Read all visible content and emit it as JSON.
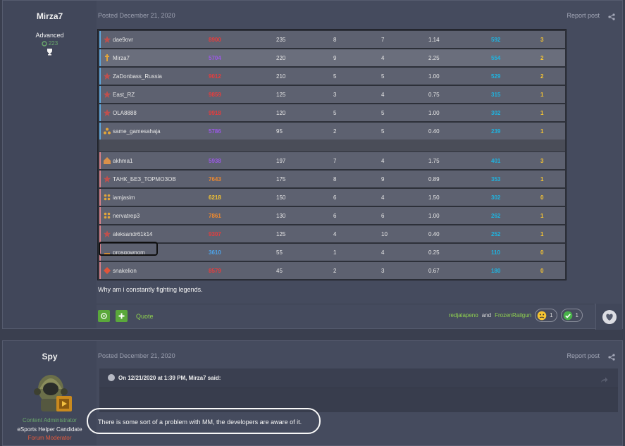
{
  "post1": {
    "author": "Mirza7",
    "rank": "Advanced",
    "reputation": "223",
    "date": "Posted December 21, 2020",
    "report": "Report post",
    "body": "Why am i constantly fighting legends.",
    "quote_label": "Quote",
    "reacted_by": [
      "redjalapeno",
      "FrozenRailgun"
    ],
    "reacted_and": "and",
    "reactions": [
      {
        "icon": "confused-face-icon",
        "count": "1"
      },
      {
        "icon": "check-icon",
        "count": "1"
      }
    ]
  },
  "scoreboard": {
    "team_blue": [
      {
        "name": "dae9ovr",
        "elo": "8900",
        "elo_color": "#e83c3c",
        "a": "235",
        "b": "8",
        "c": "7",
        "kd": "1.14",
        "score": "592",
        "pts": "3",
        "highlight": false
      },
      {
        "name": "Mirza7",
        "elo": "5704",
        "elo_color": "#9b59e6",
        "a": "220",
        "b": "9",
        "c": "4",
        "kd": "2.25",
        "score": "554",
        "pts": "2",
        "highlight": true
      },
      {
        "name": "ZaDonbass_Russia",
        "elo": "9012",
        "elo_color": "#e83c3c",
        "a": "210",
        "b": "5",
        "c": "5",
        "kd": "1.00",
        "score": "529",
        "pts": "2",
        "highlight": false
      },
      {
        "name": "East_RZ",
        "elo": "9859",
        "elo_color": "#e83c3c",
        "a": "125",
        "b": "3",
        "c": "4",
        "kd": "0.75",
        "score": "315",
        "pts": "1",
        "highlight": false
      },
      {
        "name": "OLA8888",
        "elo": "9918",
        "elo_color": "#e83c3c",
        "a": "120",
        "b": "5",
        "c": "5",
        "kd": "1.00",
        "score": "302",
        "pts": "1",
        "highlight": false
      },
      {
        "name": "same_gamesahaja",
        "elo": "5786",
        "elo_color": "#9b59e6",
        "a": "95",
        "b": "2",
        "c": "5",
        "kd": "0.40",
        "score": "239",
        "pts": "1",
        "highlight": false
      }
    ],
    "team_red": [
      {
        "name": "akhma1",
        "elo": "5938",
        "elo_color": "#9b59e6",
        "a": "197",
        "b": "7",
        "c": "4",
        "kd": "1.75",
        "score": "401",
        "pts": "3"
      },
      {
        "name": "ТАНК_БЕЗ_ТОРМОЗОВ",
        "elo": "7643",
        "elo_color": "#f08a2e",
        "a": "175",
        "b": "8",
        "c": "9",
        "kd": "0.89",
        "score": "353",
        "pts": "1"
      },
      {
        "name": "iamjasim",
        "elo": "6218",
        "elo_color": "#f7c531",
        "a": "150",
        "b": "6",
        "c": "4",
        "kd": "1.50",
        "score": "302",
        "pts": "0"
      },
      {
        "name": "nervatrep3",
        "elo": "7861",
        "elo_color": "#f08a2e",
        "a": "130",
        "b": "6",
        "c": "6",
        "kd": "1.00",
        "score": "262",
        "pts": "1"
      },
      {
        "name": "aleksandr61k14",
        "elo": "9307",
        "elo_color": "#e83c3c",
        "a": "125",
        "b": "4",
        "c": "10",
        "kd": "0.40",
        "score": "252",
        "pts": "1"
      },
      {
        "name": "prosgownom",
        "elo": "3610",
        "elo_color": "#4ea3e8",
        "a": "55",
        "b": "1",
        "c": "4",
        "kd": "0.25",
        "score": "110",
        "pts": "0"
      },
      {
        "name": "snakelion",
        "elo": "8579",
        "elo_color": "#e83c3c",
        "a": "45",
        "b": "2",
        "c": "3",
        "kd": "0.67",
        "score": "180",
        "pts": "0"
      }
    ]
  },
  "post2": {
    "author": "Spy",
    "date": "Posted December 21, 2020",
    "report": "Report post",
    "roles": [
      "Content Administrator",
      "eSports Helper Candidate",
      "Forum Moderator"
    ],
    "quote_header": "On 12/21/2020 at 1:39 PM, Mirza7 said:",
    "body": "There is some sort of a problem with MM, the developers are aware of it."
  },
  "colors": {
    "accent_green": "#5aa83b",
    "link_green": "#8fd14f",
    "score_cyan": "#1fb3df",
    "points_yellow": "#f7c531"
  }
}
